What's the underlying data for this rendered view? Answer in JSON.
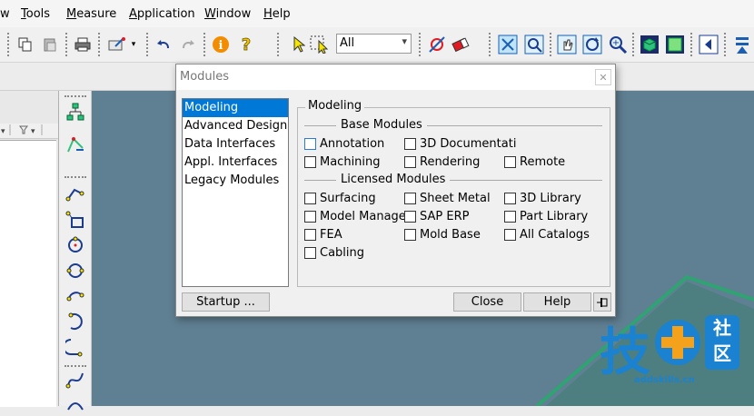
{
  "menubar": {
    "items": [
      {
        "pre": "",
        "acc": "",
        "post": "w"
      },
      {
        "pre": "",
        "acc": "T",
        "post": "ools"
      },
      {
        "pre": "",
        "acc": "M",
        "post": "easure"
      },
      {
        "pre": "",
        "acc": "A",
        "post": "pplication"
      },
      {
        "pre": "",
        "acc": "W",
        "post": "indow"
      },
      {
        "pre": "",
        "acc": "H",
        "post": "elp"
      }
    ]
  },
  "toolbar": {
    "filter_value": "All",
    "icons": [
      "copy-icon",
      "paste-icon",
      "print-icon",
      "wand-icon",
      "undo-icon",
      "redo-icon",
      "info-icon",
      "help-icon",
      "select-icon",
      "select-box-icon",
      "pick-icon",
      "erase-icon",
      "fit-icon",
      "zoom-box-icon",
      "pan-icon",
      "rotate-icon",
      "zoom-icon",
      "shaded-icon",
      "wireframe-icon",
      "prev-icon",
      "more-icon"
    ]
  },
  "dialog": {
    "title": "Modules",
    "close_glyph": "✕",
    "categories": [
      "Modeling",
      "Advanced Design",
      "Data Interfaces",
      "Appl. Interfaces",
      "Legacy Modules"
    ],
    "selected_index": 0,
    "group_title": "Modeling",
    "base_heading": "Base Modules",
    "base_modules": [
      "Annotation",
      "3D Documentati",
      "Machining",
      "Rendering",
      "Remote"
    ],
    "licensed_heading": "Licensed Modules",
    "licensed_modules": [
      "Surfacing",
      "Sheet Metal",
      "3D Library",
      "Model Manager",
      "SAP ERP",
      "Part Library",
      "FEA",
      "Mold Base",
      "All Catalogs",
      "Cabling"
    ],
    "startup_label": "Startup ...",
    "close_label": "Close",
    "help_label": "Help"
  },
  "watermark": {
    "char1": "技",
    "char2a": "社",
    "char2b": "区",
    "site": "addskills.cn"
  },
  "colors": {
    "workspace": "#5f7f92",
    "selection": "#0078d7",
    "watermark_blue": "#1a82d0",
    "watermark_orange": "#f4a21c"
  }
}
